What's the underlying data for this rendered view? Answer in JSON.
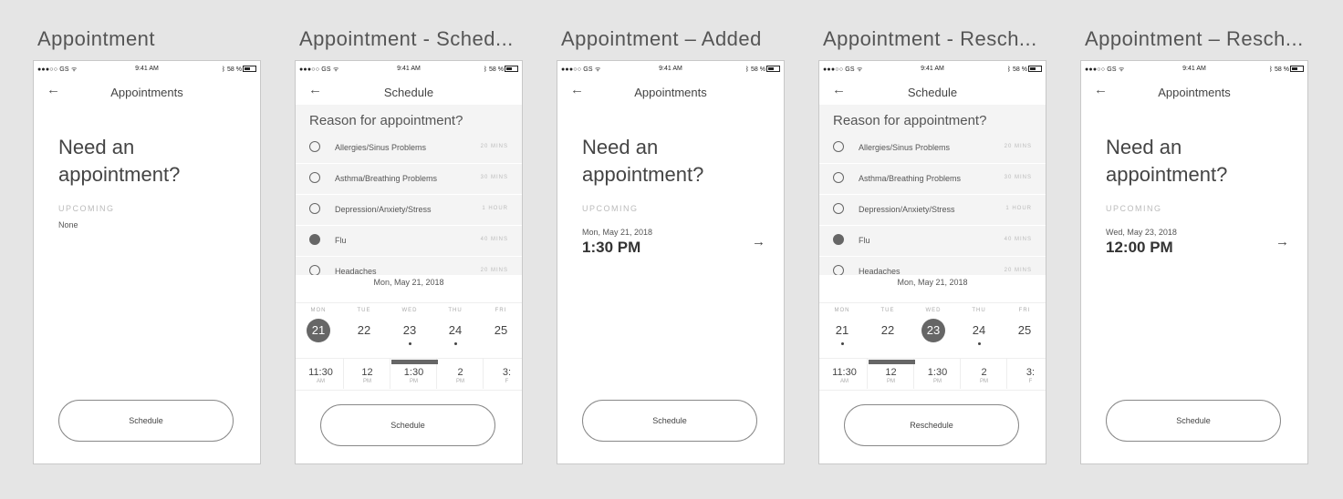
{
  "status_bar": {
    "carrier": "●●●○○ GS ᯤ",
    "time": "9:41 AM",
    "right": "ᛒ 58 %"
  },
  "screens": [
    {
      "label": "Appointment",
      "nav_title": "Appointments",
      "back_icon": "←",
      "hero_line1": "Need an",
      "hero_line2": "appointment?",
      "upcoming_label": "UPCOMING",
      "upcoming_value": "None",
      "button": "Schedule"
    },
    {
      "label": "Appointment - Sched...",
      "nav_title": "Schedule",
      "back_icon": "←",
      "button": "Schedule"
    },
    {
      "label": "Appointment – Added",
      "nav_title": "Appointments",
      "back_icon": "←",
      "hero_line1": "Need an",
      "hero_line2": "appointment?",
      "upcoming_label": "UPCOMING",
      "appt_date": "Mon, May 21, 2018",
      "appt_time": "1:30 PM",
      "arrow_icon": "→",
      "button": "Schedule"
    },
    {
      "label": "Appointment - Resch...",
      "nav_title": "Schedule",
      "back_icon": "←",
      "button": "Reschedule"
    },
    {
      "label": "Appointment – Resch...",
      "nav_title": "Appointments",
      "back_icon": "←",
      "hero_line1": "Need an",
      "hero_line2": "appointment?",
      "upcoming_label": "UPCOMING",
      "appt_date": "Wed, May 23, 2018",
      "appt_time": "12:00 PM",
      "arrow_icon": "→",
      "button": "Schedule"
    }
  ],
  "schedule": {
    "reason_title": "Reason for appointment?",
    "reasons": [
      {
        "name": "Allergies/Sinus Problems",
        "duration": "20 MINS"
      },
      {
        "name": "Asthma/Breathing Problems",
        "duration": "30 MINS"
      },
      {
        "name": "Depression/Anxiety/Stress",
        "duration": "1 HOUR"
      },
      {
        "name": "Flu",
        "duration": "40 MINS"
      },
      {
        "name": "Headaches",
        "duration": "20 MINS"
      }
    ],
    "selected_reason": "Flu",
    "selected_date": "Mon, May 21, 2018",
    "days": [
      {
        "name": "MON",
        "num": "21"
      },
      {
        "name": "TUE",
        "num": "22"
      },
      {
        "name": "WED",
        "num": "23"
      },
      {
        "name": "THU",
        "num": "24"
      },
      {
        "name": "FRI",
        "num": "25"
      }
    ],
    "slots": [
      {
        "time": "11:30",
        "period": "AM"
      },
      {
        "time": "12",
        "period": "PM"
      },
      {
        "time": "1:30",
        "period": "PM"
      },
      {
        "time": "2",
        "period": "PM"
      },
      {
        "time": "3:",
        "period": "F"
      }
    ],
    "schedule_state": {
      "selected_day": "21",
      "selected_slot": "1:30"
    },
    "reschedule_state": {
      "selected_day": "23",
      "selected_slot": "12"
    },
    "days_with_dots": [
      "21",
      "23",
      "24"
    ]
  },
  "colors": {
    "background": "#e5e5e5",
    "accent": "#666666"
  }
}
